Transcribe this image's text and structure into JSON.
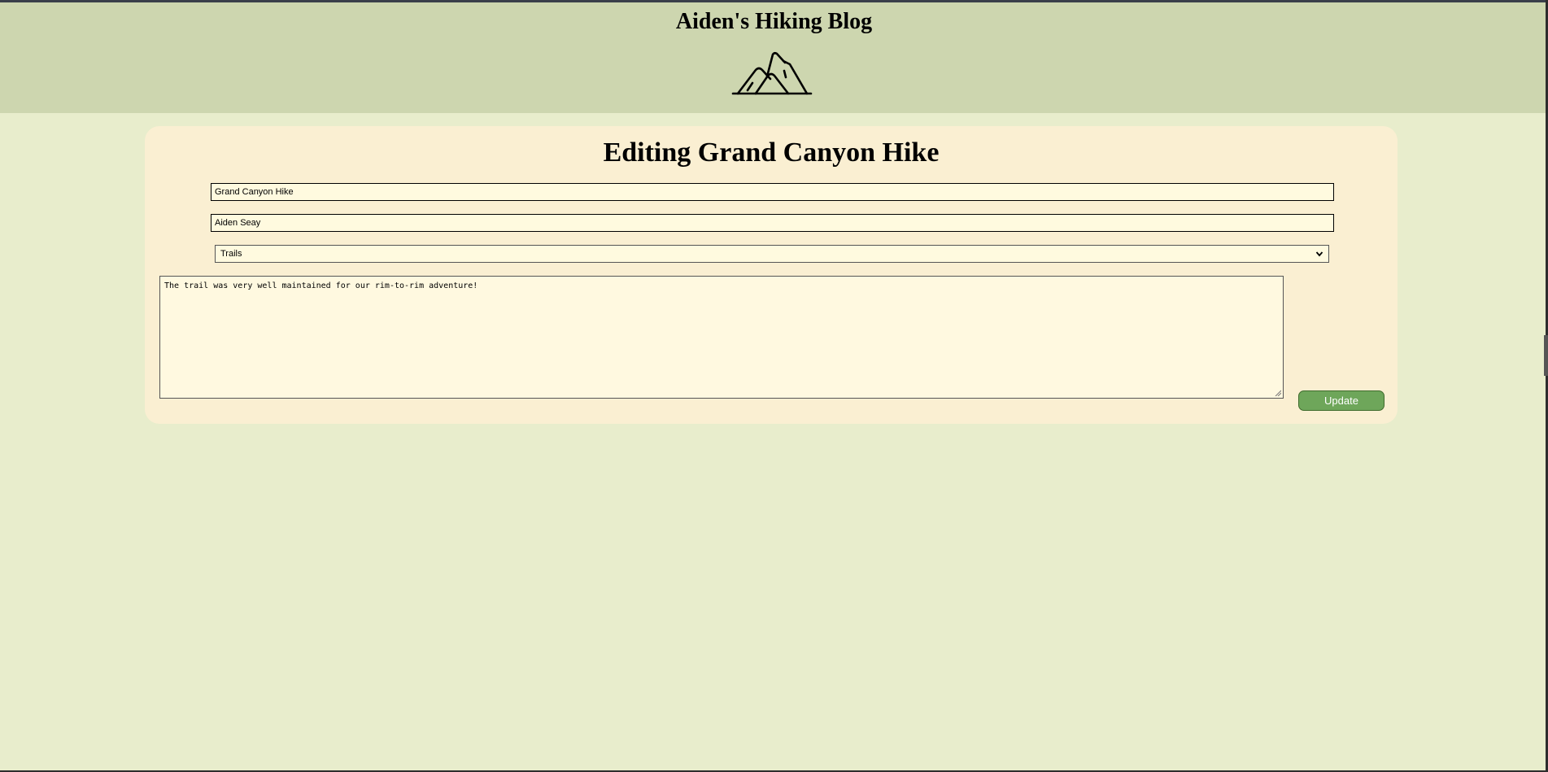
{
  "header": {
    "site_title": "Aiden's Hiking Blog",
    "logo_icon": "mountain-icon"
  },
  "form": {
    "heading": "Editing Grand Canyon Hike",
    "title_value": "Grand Canyon Hike",
    "author_value": "Aiden Seay",
    "category_selected": "Trails",
    "content_value": "The trail was very well maintained for our rim-to-rim adventure!",
    "update_label": "Update"
  },
  "colors": {
    "page_background": "#e8edcc",
    "header_background": "#cdd6af",
    "card_background": "#faefd2",
    "button_background": "#6ea65a"
  }
}
